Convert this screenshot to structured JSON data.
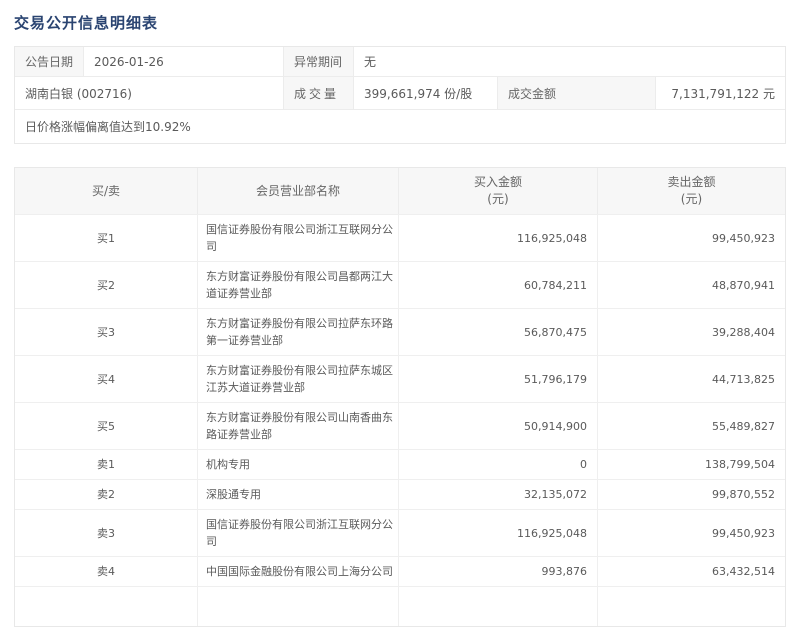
{
  "page": {
    "title": "交易公开信息明细表"
  },
  "info": {
    "announce_date_label": "公告日期",
    "announce_date": "2026-01-26",
    "abnormal_period_label": "异常期间",
    "abnormal_period": "无",
    "stock": "湖南白银 (002716)",
    "volume_label": "成交量",
    "volume": "399,661,974 份/股",
    "turnover_label": "成交金额",
    "turnover": "7,131,791,122 元",
    "note": "日价格涨幅偏离值达到10.92%"
  },
  "table": {
    "headers": [
      "买/卖",
      "会员营业部名称",
      "买入金额\n(元)",
      "卖出金额\n(元)"
    ],
    "rows": [
      {
        "side": "买1",
        "name": "国信证券股份有限公司浙江互联网分公司",
        "buy": "116,925,048",
        "sell": "99,450,923"
      },
      {
        "side": "买2",
        "name": "东方财富证券股份有限公司昌都两江大道证券营业部",
        "buy": "60,784,211",
        "sell": "48,870,941"
      },
      {
        "side": "买3",
        "name": "东方财富证券股份有限公司拉萨东环路第一证券营业部",
        "buy": "56,870,475",
        "sell": "39,288,404"
      },
      {
        "side": "买4",
        "name": "东方财富证券股份有限公司拉萨东城区江苏大道证券营业部",
        "buy": "51,796,179",
        "sell": "44,713,825"
      },
      {
        "side": "买5",
        "name": "东方财富证券股份有限公司山南香曲东路证券营业部",
        "buy": "50,914,900",
        "sell": "55,489,827"
      },
      {
        "side": "卖1",
        "name": "机构专用",
        "buy": "0",
        "sell": "138,799,504"
      },
      {
        "side": "卖2",
        "name": "深股通专用",
        "buy": "32,135,072",
        "sell": "99,870,552"
      },
      {
        "side": "卖3",
        "name": "国信证券股份有限公司浙江互联网分公司",
        "buy": "116,925,048",
        "sell": "99,450,923"
      },
      {
        "side": "卖4",
        "name": "中国国际金融股份有限公司上海分公司",
        "buy": "993,876",
        "sell": "63,432,514"
      }
    ]
  }
}
